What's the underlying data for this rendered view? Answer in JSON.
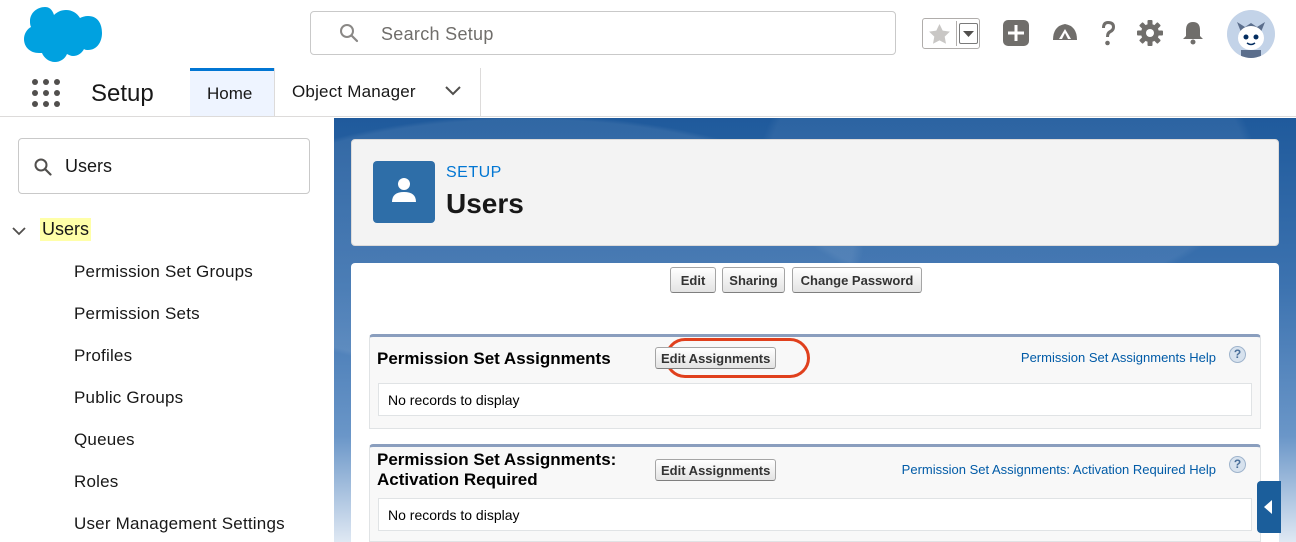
{
  "header": {
    "search_placeholder": "Search Setup",
    "icons": [
      "favorites-star-icon",
      "favorites-list-icon",
      "add-icon",
      "trailhead-icon",
      "help-icon",
      "setup-gear-icon",
      "notifications-bell-icon",
      "user-avatar"
    ]
  },
  "context_bar": {
    "app_name": "Setup",
    "tabs": [
      {
        "label": "Home",
        "active": true
      },
      {
        "label": "Object Manager",
        "has_dropdown": true
      }
    ]
  },
  "sidebar": {
    "quick_find_value": "Users",
    "tree_root": "Users",
    "items": [
      "Permission Set Groups",
      "Permission Sets",
      "Profiles",
      "Public Groups",
      "Queues",
      "Roles",
      "User Management Settings"
    ]
  },
  "page_header": {
    "breadcrumb": "SETUP",
    "title": "Users"
  },
  "actions": {
    "edit": "Edit",
    "sharing": "Sharing",
    "change_password": "Change Password"
  },
  "related_lists": [
    {
      "title": "Permission Set Assignments",
      "button": "Edit Assignments",
      "help": "Permission Set Assignments Help",
      "empty": "No records to display",
      "highlighted": true
    },
    {
      "title_line1": "Permission Set Assignments:",
      "title_line2": "Activation Required",
      "button": "Edit Assignments",
      "help": "Permission Set Assignments: Activation Required Help",
      "empty": "No records to display"
    }
  ],
  "colors": {
    "brand": "#0176d3",
    "highlight_ring": "#e0401d",
    "search_highlight": "#ffffa8"
  }
}
